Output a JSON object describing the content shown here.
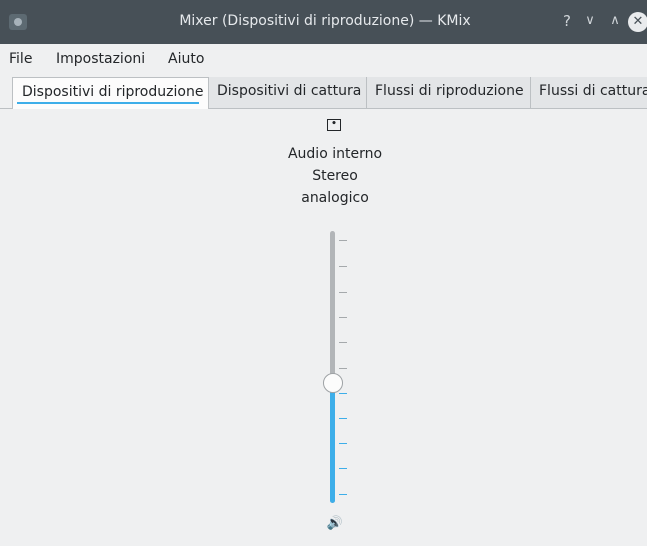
{
  "window": {
    "title": "Mixer (Dispositivi di riproduzione) — KMix",
    "buttons": {
      "help": "?",
      "minimize": "⌵",
      "maximize": "^",
      "close": "✕"
    }
  },
  "menubar": {
    "items": [
      "File",
      "Impostazioni",
      "Aiuto"
    ]
  },
  "tabs": [
    {
      "label": "Dispositivi di riproduzione",
      "active": true
    },
    {
      "label": "Dispositivi di cattura",
      "active": false
    },
    {
      "label": "Flussi di riproduzione",
      "active": false
    },
    {
      "label": "Flussi di cattura",
      "active": false
    }
  ],
  "device": {
    "icon": "audio-card-icon",
    "label": "Audio interno\nStereo\nanalogico",
    "volume_fraction": 0.44,
    "mute_icon": "speaker-icon"
  },
  "colors": {
    "accent": "#3daee9",
    "titlebar": "#475057",
    "background": "#eff0f1"
  }
}
